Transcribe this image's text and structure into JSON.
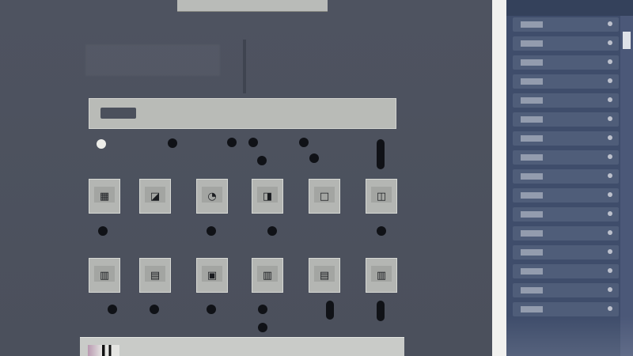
{
  "app": {
    "top_tab_label": "",
    "toolbar_label": "",
    "accent": "#4b505c",
    "sidebar_bg": "#3f4d6b",
    "divider_color": "#f1f1ef"
  },
  "canvas": {
    "nodes": [
      {
        "icon": "box-icon"
      },
      {
        "icon": "diagonal-icon"
      },
      {
        "icon": "curve-icon"
      },
      {
        "icon": "split-icon"
      },
      {
        "icon": "square-icon"
      },
      {
        "icon": "bracket-icon"
      },
      {
        "icon": "box-icon"
      },
      {
        "icon": "box-icon"
      },
      {
        "icon": "box-icon"
      },
      {
        "icon": "box-icon"
      },
      {
        "icon": "box-icon"
      },
      {
        "icon": "box-icon"
      }
    ]
  },
  "sidebar": {
    "rows": [
      {
        "id": "row-1"
      },
      {
        "id": "row-2"
      },
      {
        "id": "row-3"
      },
      {
        "id": "row-4"
      },
      {
        "id": "row-5"
      },
      {
        "id": "row-6"
      },
      {
        "id": "row-7"
      },
      {
        "id": "row-8"
      },
      {
        "id": "row-9"
      },
      {
        "id": "row-10"
      },
      {
        "id": "row-11"
      },
      {
        "id": "row-12"
      },
      {
        "id": "row-13"
      },
      {
        "id": "row-14"
      },
      {
        "id": "row-15"
      },
      {
        "id": "row-16"
      }
    ]
  }
}
